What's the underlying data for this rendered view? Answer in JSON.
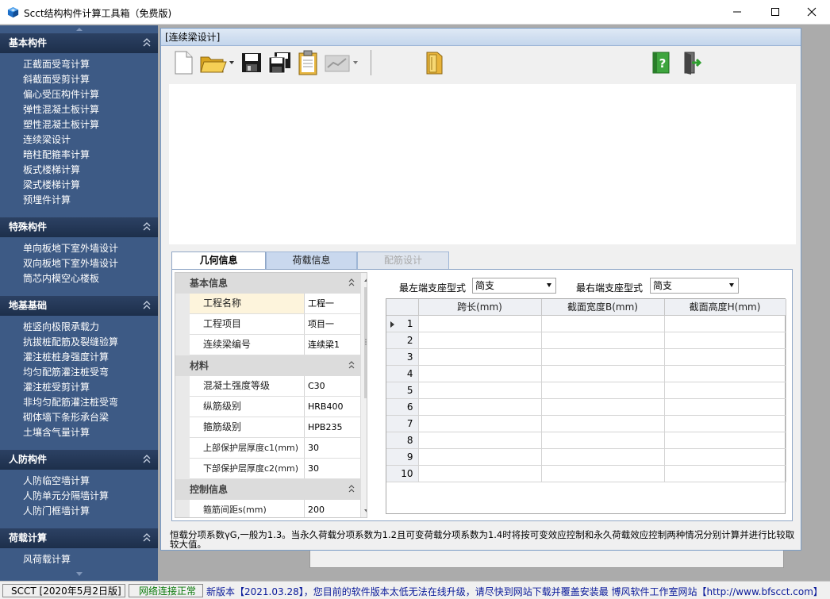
{
  "window": {
    "title": "Scct结构构件计算工具箱（免费版)",
    "controls": {
      "minimize": "—",
      "maximize": "☐",
      "close": "✕"
    }
  },
  "sidebar": {
    "sections": [
      {
        "title": "基本构件",
        "items": [
          "正截面受弯计算",
          "斜截面受剪计算",
          "偏心受压构件计算",
          "弹性混凝土板计算",
          "塑性混凝土板计算",
          "连续梁设计",
          "暗柱配箍率计算",
          "板式楼梯计算",
          "梁式楼梯计算",
          "预埋件计算"
        ]
      },
      {
        "title": "特殊构件",
        "items": [
          "单向板地下室外墙设计",
          "双向板地下室外墙设计",
          "筒芯内模空心楼板"
        ]
      },
      {
        "title": "地基基础",
        "items": [
          "桩竖向极限承载力",
          "抗拔桩配筋及裂缝验算",
          "灌注桩桩身强度计算",
          "均匀配筋灌注桩受弯",
          "灌注桩受剪计算",
          "非均匀配筋灌注桩受弯",
          "砌体墙下条形承台梁",
          "土壤含气量计算"
        ]
      },
      {
        "title": "人防构件",
        "items": [
          "人防临空墙计算",
          "人防单元分隔墙计算",
          "人防门框墙计算"
        ]
      },
      {
        "title": "荷载计算",
        "items": [
          "风荷载计算"
        ]
      }
    ]
  },
  "child_window": {
    "title": "[连续梁设计]",
    "toolbar": {
      "icons": [
        "new-file-icon",
        "open-folder-icon",
        "save-icon",
        "save-all-icon",
        "clipboard-icon",
        "chart-icon",
        "folder-book-icon",
        "help-book-icon",
        "exit-door-icon"
      ]
    },
    "tabs": [
      {
        "label": "几何信息",
        "state": "active"
      },
      {
        "label": "荷载信息",
        "state": "normal"
      },
      {
        "label": "配筋设计",
        "state": "disabled"
      }
    ],
    "property_grid": {
      "categories": [
        {
          "name": "基本信息",
          "rows": [
            {
              "key": "工程名称",
              "value": "工程一"
            },
            {
              "key": "工程项目",
              "value": "项目一"
            },
            {
              "key": "连续梁编号",
              "value": "连续梁1"
            }
          ]
        },
        {
          "name": "材料",
          "rows": [
            {
              "key": "混凝土强度等级",
              "value": "C30"
            },
            {
              "key": "纵筋级别",
              "value": "HRB400"
            },
            {
              "key": "箍筋级别",
              "value": "HPB235"
            },
            {
              "key": "上部保护层厚度c1(mm)",
              "value": "30"
            },
            {
              "key": "下部保护层厚度c2(mm)",
              "value": "30"
            }
          ]
        },
        {
          "name": "控制信息",
          "rows": [
            {
              "key": "箍筋间距s(mm)",
              "value": "200"
            }
          ]
        }
      ]
    },
    "supports": {
      "left_label": "最左端支座型式",
      "left_value": "简支",
      "right_label": "最右端支座型式",
      "right_value": "简支"
    },
    "span_table": {
      "columns": [
        "跨长(mm)",
        "截面宽度B(mm)",
        "截面高度H(mm)"
      ],
      "rows": [
        "1",
        "2",
        "3",
        "4",
        "5",
        "6",
        "7",
        "8",
        "9",
        "10"
      ]
    },
    "note": "恒载分项系数γG,一般为1.3。当永久荷载分项系数为1.2且可变荷载分项系数为1.4时将按可变效应控制和永久荷载效应控制两种情况分别计算并进行比较取较大值。"
  },
  "statusbar": {
    "version": "SCCT  [2020年5月2日版]",
    "network": "网络连接正常",
    "update": "新版本【2021.03.28】，您目前的软件版本太低无法在线升级，请尽快到网站下载并覆盖安装最",
    "site": "博风软件工作室网站【http://www.bfscct.com】"
  },
  "colors": {
    "sidebar_bg": "#3d5a85",
    "sidebar_head": "#1d2f4b",
    "status_green": "#0a7a0a",
    "status_blue": "#0a1a9a"
  }
}
